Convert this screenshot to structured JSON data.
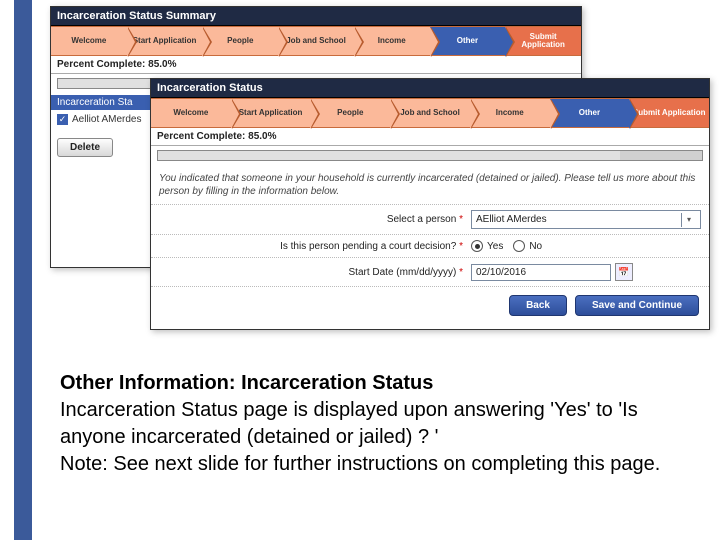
{
  "slide": {
    "heading": "Other Information: Incarceration Status",
    "body1": "Incarceration Status page is displayed upon answering 'Yes' to 'Is anyone incarcerated (detained or jailed) ? '",
    "body2": "Note: See next slide for further instructions on completing this page."
  },
  "nav_steps": [
    "Welcome",
    "Start Application",
    "People",
    "Job and School",
    "Income",
    "Other",
    "Submit Application"
  ],
  "active_step_index": 5,
  "percent_label": "Percent Complete: 85.0%",
  "percent_value": 85,
  "win1": {
    "title": "Incarceration Status Summary",
    "subhead_truncated": "Incarceration Sta",
    "checked_name_truncated": "Aelliot AMerdes",
    "delete_label": "Delete"
  },
  "win2": {
    "title": "Incarceration Status",
    "intro": "You indicated that someone in your household is currently incarcerated (detained or jailed). Please tell us more about this person by filling in the information below.",
    "fields": {
      "person_label": "Select a person",
      "person_value": "AElliot AMerdes",
      "pending_label": "Is this person pending a court decision?",
      "pending_yes": "Yes",
      "pending_no": "No",
      "date_label": "Start Date (mm/dd/yyyy)",
      "date_value": "02/10/2016"
    },
    "buttons": {
      "back": "Back",
      "save": "Save and Continue"
    }
  }
}
